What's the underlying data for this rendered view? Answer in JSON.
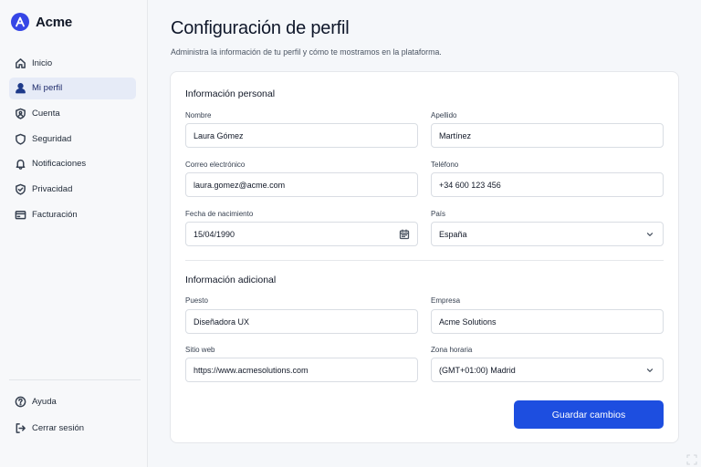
{
  "app": {
    "name": "Acme",
    "logo_letter": "A",
    "accent": "#3646e6"
  },
  "sidebar": {
    "items": [
      {
        "label": "Inicio",
        "icon": "home-icon",
        "active": false
      },
      {
        "label": "Mi perfil",
        "icon": "user-icon",
        "active": true
      },
      {
        "label": "Cuenta",
        "icon": "shield-user-icon",
        "active": false
      },
      {
        "label": "Seguridad",
        "icon": "shield-icon",
        "active": false
      },
      {
        "label": "Notificaciones",
        "icon": "bell-icon",
        "active": false
      },
      {
        "label": "Privacidad",
        "icon": "shield-check-icon",
        "active": false
      },
      {
        "label": "Facturación",
        "icon": "credit-card-icon",
        "active": false
      }
    ],
    "bottom": [
      {
        "label": "Ayuda",
        "icon": "help-icon"
      },
      {
        "label": "Cerrar sesión",
        "icon": "logout-icon"
      }
    ]
  },
  "header": {
    "title": "Configuración de perfil",
    "subtitle": "Administra la información de tu perfil y cómo te mostramos en la plataforma."
  },
  "personal": {
    "title": "Información personal",
    "nombre_label": "Nombre",
    "nombre_value": "Laura Gómez",
    "apellido_label": "Apellido",
    "apellido_value": "Martínez",
    "correo_label": "Correo electrónico",
    "correo_value": "laura.gomez@acme.com",
    "telefono_label": "Teléfono",
    "telefono_value": "+34 600 123 456",
    "nacimiento_label": "Fecha de nacimiento",
    "nacimiento_value": "15/04/1990",
    "pais_label": "País",
    "pais_value": "España"
  },
  "additional": {
    "title": "Información adicional",
    "puesto_label": "Puesto",
    "puesto_value": "Diseñadora UX",
    "empresa_label": "Empresa",
    "empresa_value": "Acme Solutions",
    "web_label": "Sitio web",
    "web_value": "https://www.acmesolutions.com",
    "zona_label": "Zona horaria",
    "zona_value": "(GMT+01:00) Madrid"
  },
  "actions": {
    "save_label": "Guardar cambios",
    "save_color": "#1d4ee0"
  }
}
